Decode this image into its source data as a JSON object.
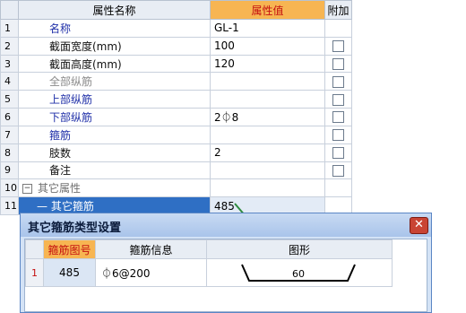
{
  "grid": {
    "header": {
      "name": "属性名称",
      "value": "属性值",
      "extra": "附加"
    },
    "rows": [
      {
        "num": "1",
        "name": "名称",
        "value": "GL-1",
        "color": "blue",
        "checkbox": false
      },
      {
        "num": "2",
        "name": "截面宽度(mm)",
        "value": "100",
        "color": "black",
        "checkbox": true
      },
      {
        "num": "3",
        "name": "截面高度(mm)",
        "value": "120",
        "color": "black",
        "checkbox": true
      },
      {
        "num": "4",
        "name": "全部纵筋",
        "value": "",
        "color": "gray",
        "checkbox": true
      },
      {
        "num": "5",
        "name": "上部纵筋",
        "value": "",
        "color": "blue",
        "checkbox": true
      },
      {
        "num": "6",
        "name": "下部纵筋",
        "value": "2⏀8",
        "color": "blue",
        "checkbox": true
      },
      {
        "num": "7",
        "name": "箍筋",
        "value": "",
        "color": "blue",
        "checkbox": true
      },
      {
        "num": "8",
        "name": "肢数",
        "value": "2",
        "color": "black",
        "checkbox": true
      },
      {
        "num": "9",
        "name": "备注",
        "value": "",
        "color": "black",
        "checkbox": true
      },
      {
        "num": "10",
        "name": "其它属性",
        "value": "",
        "color": "group",
        "checkbox": false,
        "toggle": "−"
      },
      {
        "num": "11",
        "name": "— 其它箍筋",
        "value": "485",
        "color": "selected",
        "checkbox": false
      }
    ]
  },
  "dialog": {
    "title": "其它箍筋类型设置",
    "close": "✕",
    "columns": [
      "箍筋图号",
      "箍筋信息",
      "图形"
    ],
    "rows": [
      {
        "num": "1",
        "code": "485",
        "info": "⏀6@200",
        "shape_value": "60"
      }
    ]
  },
  "colors": {
    "accent_header": "#f7b552",
    "selected_row": "#2f6fc4",
    "link_blue": "#1f2fa8",
    "arrow_green": "#2e8b3e",
    "close_red": "#c94434"
  }
}
